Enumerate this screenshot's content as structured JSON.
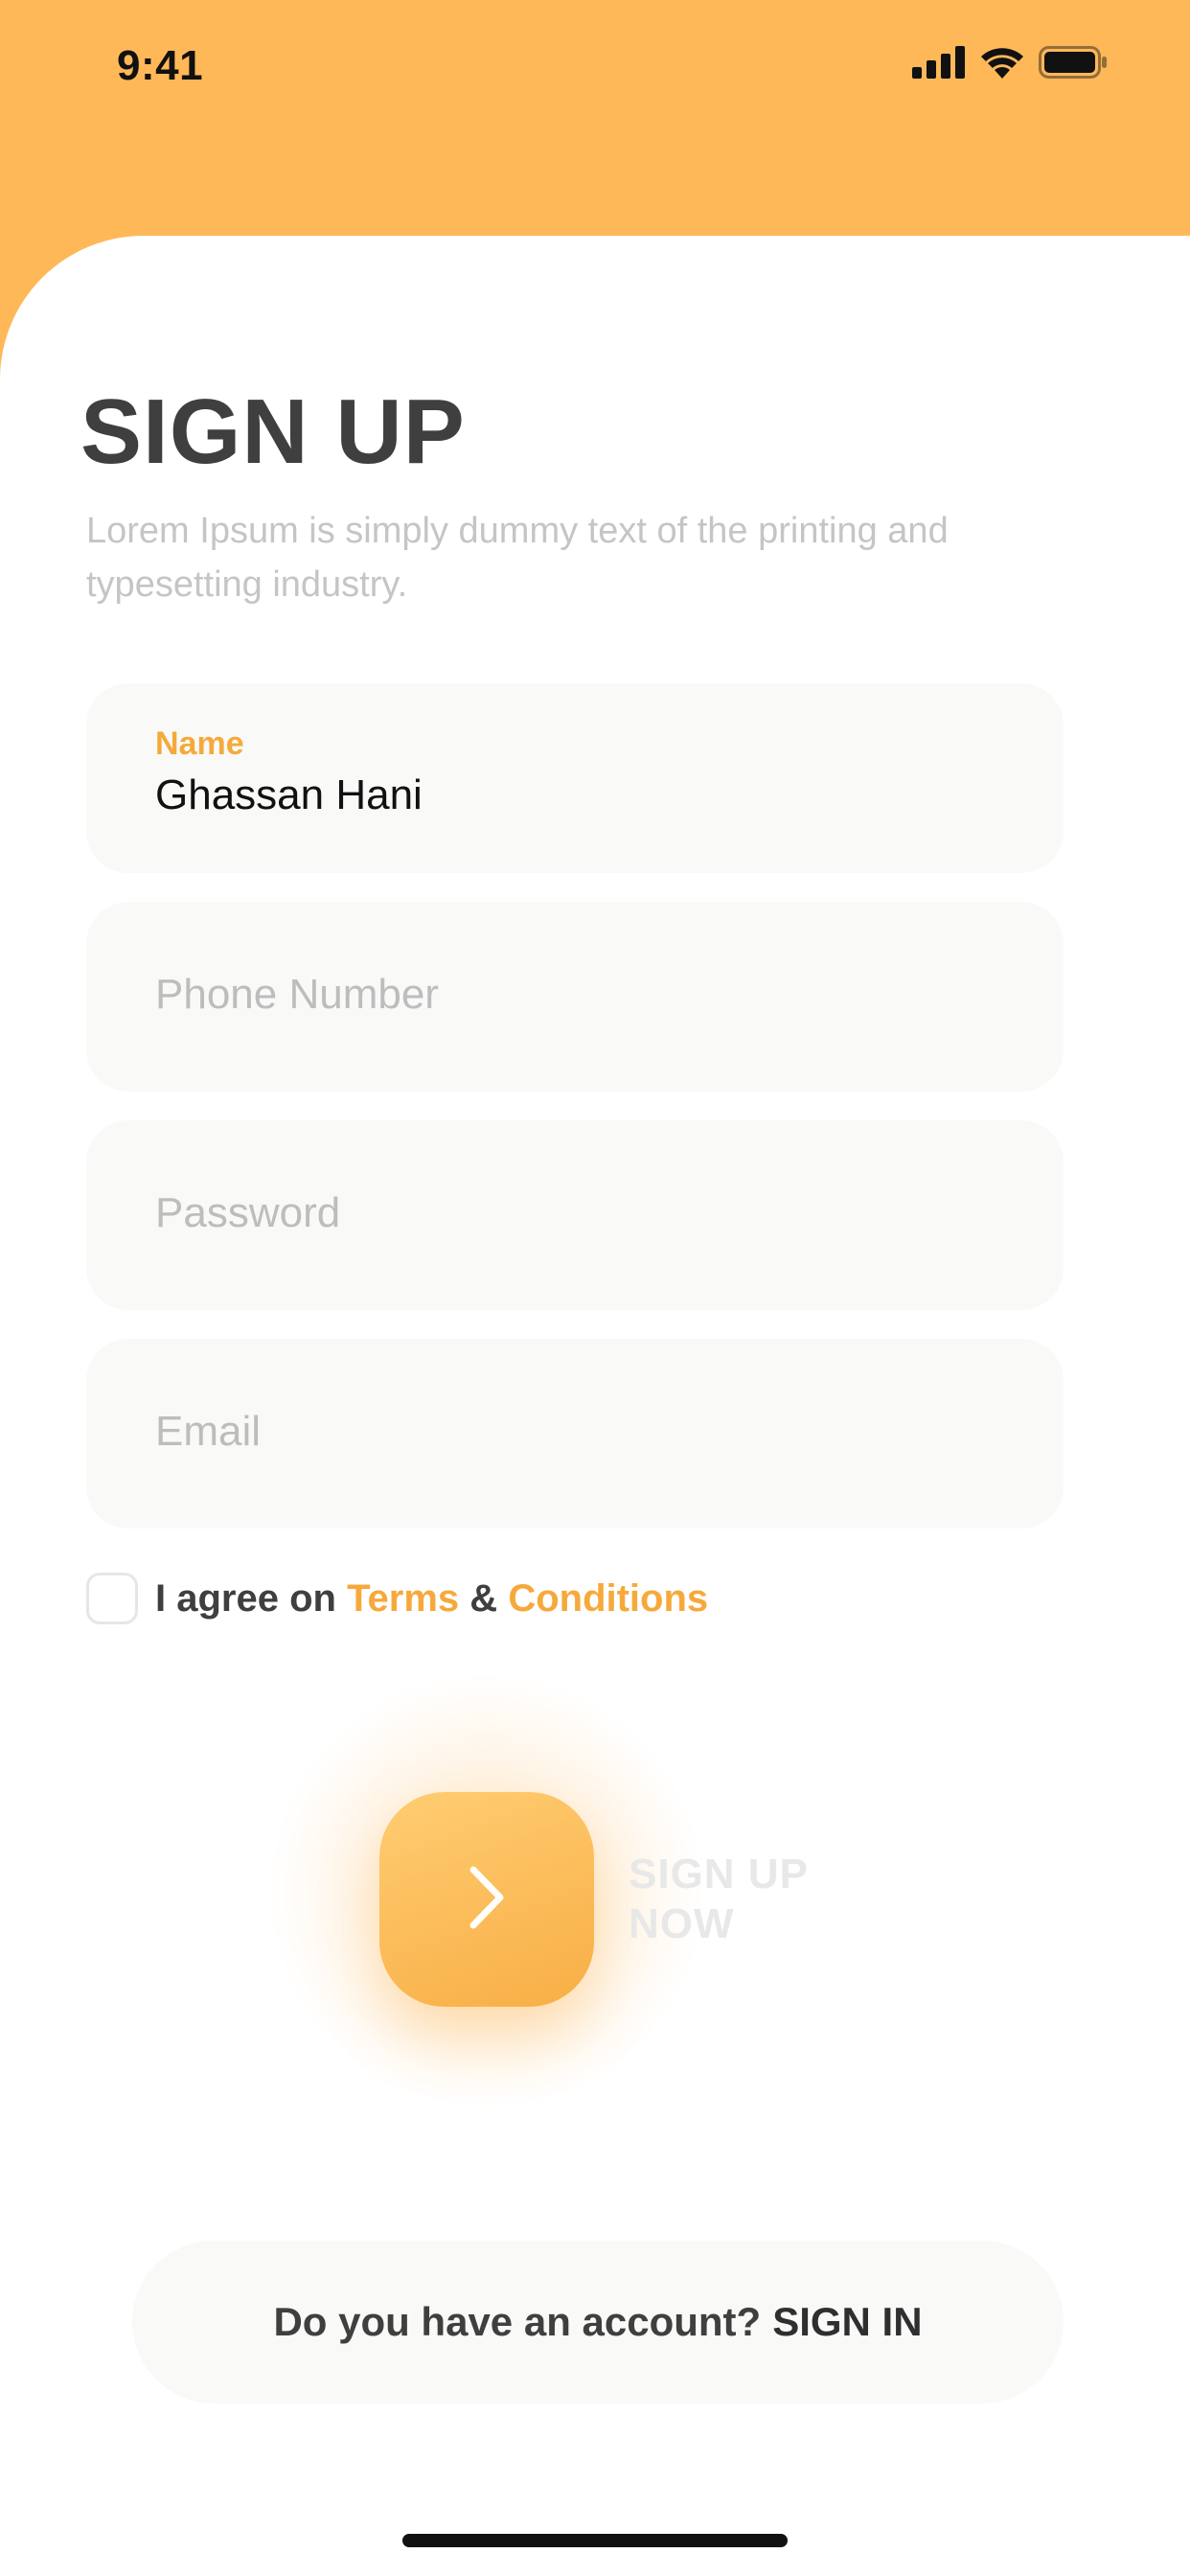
{
  "status_bar": {
    "time": "9:41",
    "icons": [
      "signal-icon",
      "wifi-icon",
      "battery-icon"
    ]
  },
  "colors": {
    "accent": "#FFB858",
    "accent_text": "#F6A93B",
    "field_bg": "#F9F9F7",
    "title": "#3F3F3F"
  },
  "header": {
    "title": "SIGN UP",
    "subtitle": "Lorem Ipsum is simply dummy text of the printing and typesetting industry."
  },
  "form": {
    "name": {
      "label": "Name",
      "value": "Ghassan Hani"
    },
    "phone": {
      "placeholder": "Phone Number"
    },
    "password": {
      "placeholder": "Password"
    },
    "email": {
      "placeholder": "Email"
    },
    "agree": {
      "prefix": "I agree on",
      "terms": "Terms",
      "ampersand": "&",
      "conditions": "Conditions",
      "checked": false
    }
  },
  "action": {
    "icon": "chevron-right-icon",
    "label_line1": "SIGN UP",
    "label_line2": "NOW"
  },
  "footer": {
    "question": "Do you have an account?",
    "link": "SIGN IN"
  }
}
